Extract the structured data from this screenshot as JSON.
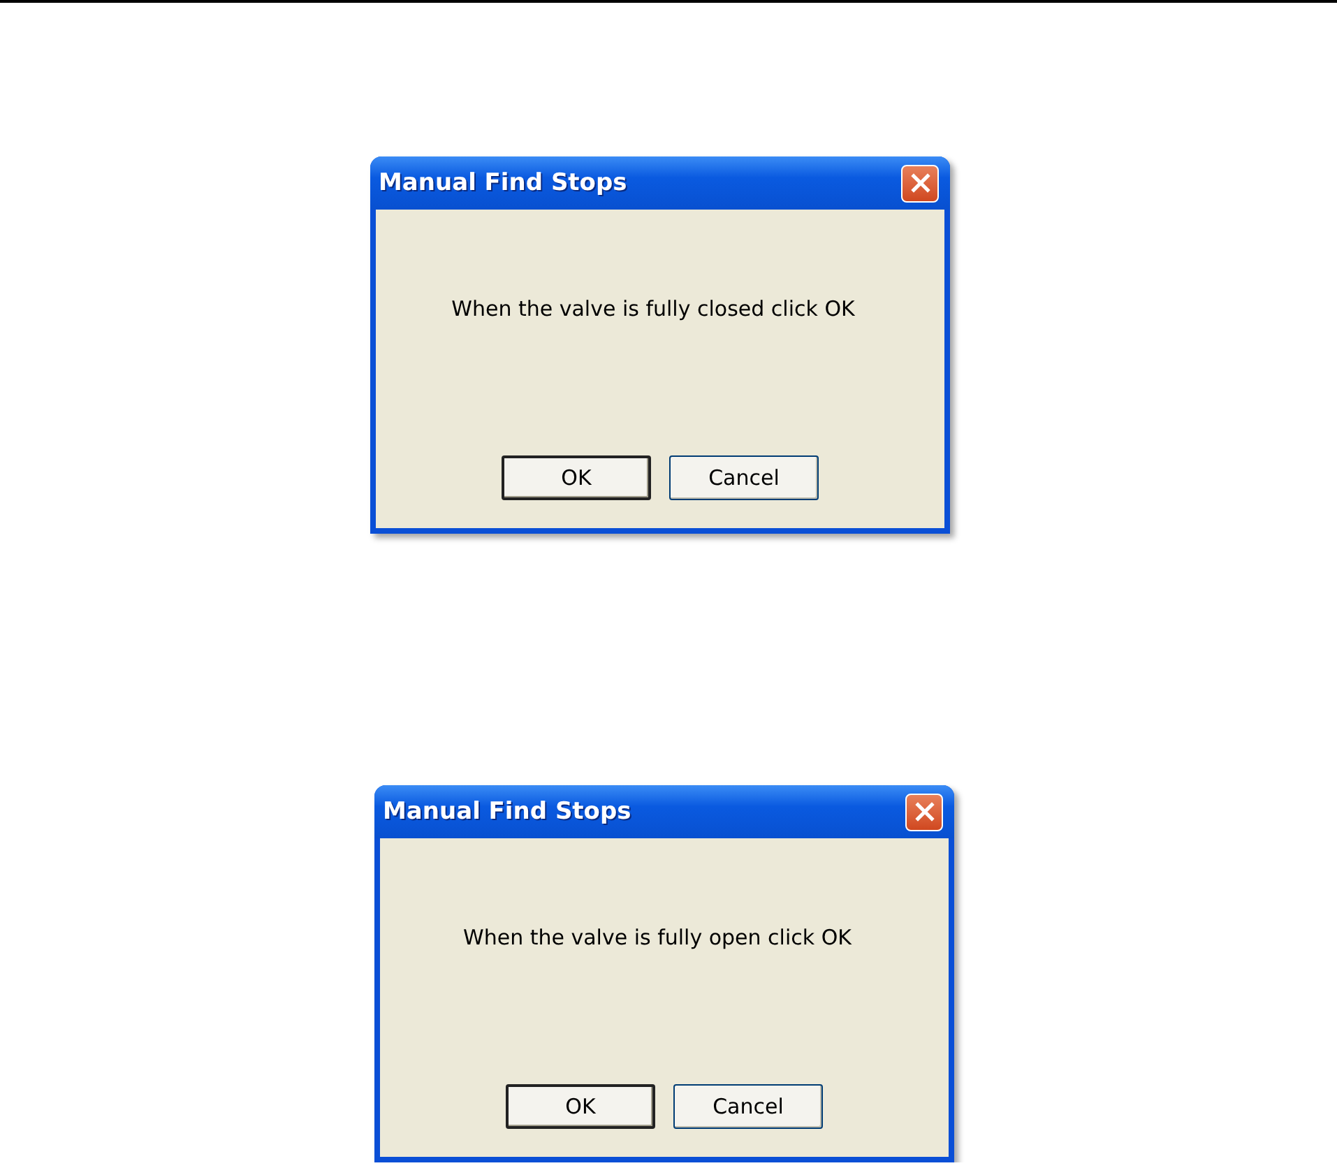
{
  "dialogs": [
    {
      "title": "Manual Find Stops",
      "message": "When the valve is fully closed click OK",
      "buttons": [
        {
          "label": "OK",
          "default": true
        },
        {
          "label": "Cancel",
          "default": false
        }
      ]
    },
    {
      "title": "Manual Find Stops",
      "message": "When the valve is fully open click OK",
      "buttons": [
        {
          "label": "OK",
          "default": true
        },
        {
          "label": "Cancel",
          "default": false
        }
      ]
    }
  ]
}
